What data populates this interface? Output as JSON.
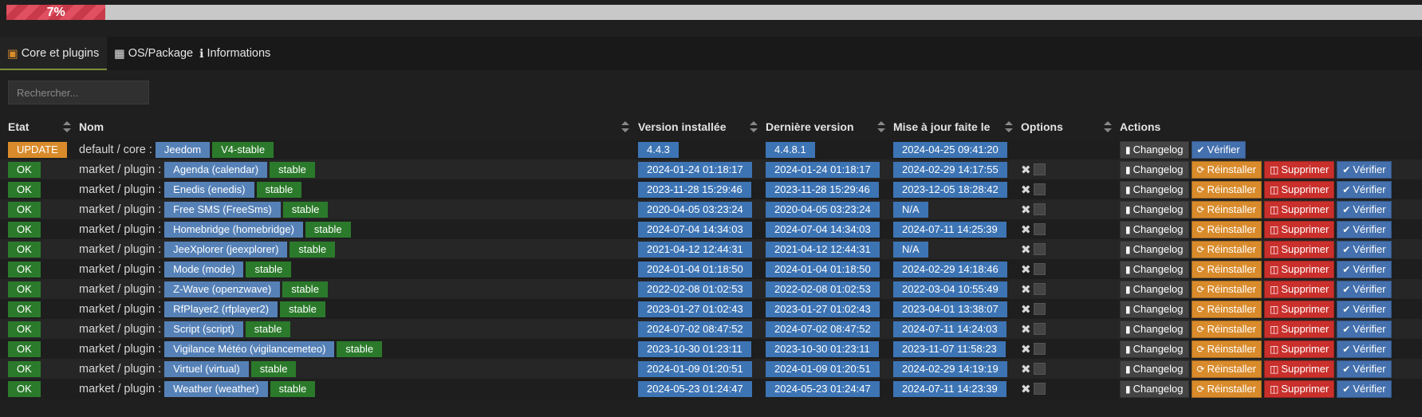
{
  "progress": {
    "label": "7%",
    "value": 7
  },
  "tabs": [
    {
      "label": "Core et plugins",
      "icon": "box-icon",
      "active": true
    },
    {
      "label": "OS/Package",
      "icon": "package-icon",
      "active": false
    },
    {
      "label": "Informations",
      "icon": "info-icon",
      "active": false
    }
  ],
  "search": {
    "placeholder": "Rechercher..."
  },
  "columns": [
    "Etat",
    "Nom",
    "Version installée",
    "Dernière version",
    "Mise à jour faite le",
    "Options",
    "Actions"
  ],
  "actions": {
    "changelog": "Changelog",
    "reinstall": "Réinstaller",
    "delete": "Supprimer",
    "verify": "Vérifier"
  },
  "colors": {
    "update": "#d98b2b",
    "ok": "#2b7a2b",
    "blue": "#3d74b4",
    "delete": "#c9302c",
    "verify": "#4470ad"
  },
  "rows": [
    {
      "etat": "UPDATE",
      "source": "default / core :",
      "name": "Jeedom",
      "branch": "V4-stable",
      "installed": "4.4.3",
      "latest": "4.4.8.1",
      "updated": "2024-04-25 09:41:20"
    },
    {
      "etat": "OK",
      "source": "market / plugin :",
      "name": "Agenda (calendar)",
      "branch": "stable",
      "installed": "2024-01-24 01:18:17",
      "latest": "2024-01-24 01:18:17",
      "updated": "2024-02-29 14:17:55"
    },
    {
      "etat": "OK",
      "source": "market / plugin :",
      "name": "Enedis (enedis)",
      "branch": "stable",
      "installed": "2023-11-28 15:29:46",
      "latest": "2023-11-28 15:29:46",
      "updated": "2023-12-05 18:28:42"
    },
    {
      "etat": "OK",
      "source": "market / plugin :",
      "name": "Free SMS (FreeSms)",
      "branch": "stable",
      "installed": "2020-04-05 03:23:24",
      "latest": "2020-04-05 03:23:24",
      "updated": "N/A"
    },
    {
      "etat": "OK",
      "source": "market / plugin :",
      "name": "Homebridge (homebridge)",
      "branch": "stable",
      "installed": "2024-07-04 14:34:03",
      "latest": "2024-07-04 14:34:03",
      "updated": "2024-07-11 14:25:39"
    },
    {
      "etat": "OK",
      "source": "market / plugin :",
      "name": "JeeXplorer (jeexplorer)",
      "branch": "stable",
      "installed": "2021-04-12 12:44:31",
      "latest": "2021-04-12 12:44:31",
      "updated": "N/A"
    },
    {
      "etat": "OK",
      "source": "market / plugin :",
      "name": "Mode (mode)",
      "branch": "stable",
      "installed": "2024-01-04 01:18:50",
      "latest": "2024-01-04 01:18:50",
      "updated": "2024-02-29 14:18:46"
    },
    {
      "etat": "OK",
      "source": "market / plugin :",
      "name": "Z-Wave (openzwave)",
      "branch": "stable",
      "installed": "2022-02-08 01:02:53",
      "latest": "2022-02-08 01:02:53",
      "updated": "2022-03-04 10:55:49"
    },
    {
      "etat": "OK",
      "source": "market / plugin :",
      "name": "RfPlayer2 (rfplayer2)",
      "branch": "stable",
      "installed": "2023-01-27 01:02:43",
      "latest": "2023-01-27 01:02:43",
      "updated": "2023-04-01 13:38:07"
    },
    {
      "etat": "OK",
      "source": "market / plugin :",
      "name": "Script (script)",
      "branch": "stable",
      "installed": "2024-07-02 08:47:52",
      "latest": "2024-07-02 08:47:52",
      "updated": "2024-07-11 14:24:03"
    },
    {
      "etat": "OK",
      "source": "market / plugin :",
      "name": "Vigilance Météo (vigilancemeteo)",
      "branch": "stable",
      "installed": "2023-10-30 01:23:11",
      "latest": "2023-10-30 01:23:11",
      "updated": "2023-11-07 11:58:23"
    },
    {
      "etat": "OK",
      "source": "market / plugin :",
      "name": "Virtuel (virtual)",
      "branch": "stable",
      "installed": "2024-01-09 01:20:51",
      "latest": "2024-01-09 01:20:51",
      "updated": "2024-02-29 14:19:19"
    },
    {
      "etat": "OK",
      "source": "market / plugin :",
      "name": "Weather (weather)",
      "branch": "stable",
      "installed": "2024-05-23 01:24:47",
      "latest": "2024-05-23 01:24:47",
      "updated": "2024-07-11 14:23:39"
    }
  ]
}
